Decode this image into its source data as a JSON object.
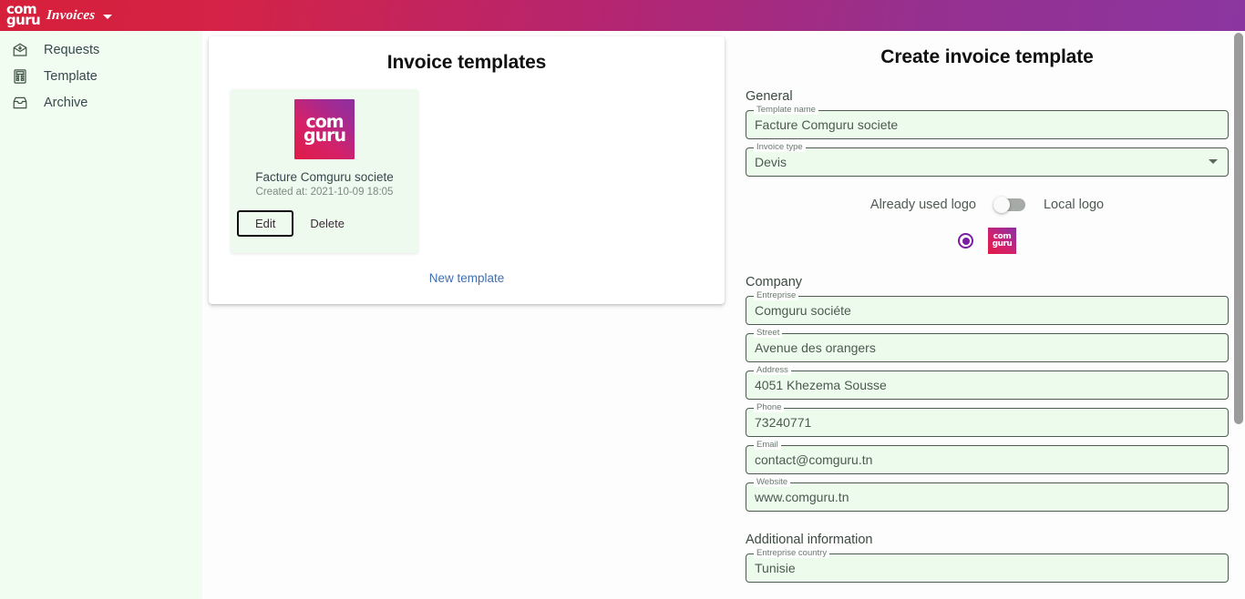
{
  "header": {
    "logo_line1": "com",
    "logo_line2": "guru",
    "app_name": "Invoices",
    "caret": "chevron-down-icon"
  },
  "sidebar": {
    "items": [
      {
        "label": "Requests",
        "icon": "requests-envelope-icon"
      },
      {
        "label": "Template",
        "icon": "template-calculator-icon"
      },
      {
        "label": "Archive",
        "icon": "archive-box-icon"
      }
    ]
  },
  "templates_panel": {
    "title": "Invoice templates",
    "new_template_label": "New template",
    "cards": [
      {
        "logo_line1": "com",
        "logo_line2": "guru",
        "name": "Facture Comguru societe",
        "created": "Created at: 2021-10-09 18:05",
        "edit_label": "Edit",
        "delete_label": "Delete"
      }
    ]
  },
  "form": {
    "title": "Create invoice template",
    "sections": {
      "general": "General",
      "company": "Company",
      "additional": "Additional information"
    },
    "fields": {
      "template_name": {
        "label": "Template name",
        "value": "Facture Comguru societe"
      },
      "invoice_type": {
        "label": "Invoice type",
        "value": "Devis"
      },
      "entreprise": {
        "label": "Entreprise",
        "value": "Comguru sociéte"
      },
      "street": {
        "label": "Street",
        "value": "Avenue des orangers"
      },
      "address": {
        "label": "Address",
        "value": "4051 Khezema Sousse"
      },
      "phone": {
        "label": "Phone",
        "value": "73240771"
      },
      "email": {
        "label": "Email",
        "value": "contact@comguru.tn"
      },
      "website": {
        "label": "Website",
        "value": "www.comguru.tn"
      },
      "entreprise_country": {
        "label": "Entreprise country",
        "value": "Tunisie"
      }
    },
    "logo_toggle": {
      "left_label": "Already used logo",
      "right_label": "Local logo",
      "state": "off"
    },
    "logo_choice": {
      "selected": true,
      "swatch_line1": "com",
      "swatch_line2": "guru"
    }
  },
  "colors": {
    "header_start": "#d61f3a",
    "header_end": "#8b36a0",
    "sidebar_bg": "#f1fdf1",
    "field_bg": "#edfbed",
    "link": "#3f6fb5",
    "radio_accent": "#7b1fa2"
  }
}
